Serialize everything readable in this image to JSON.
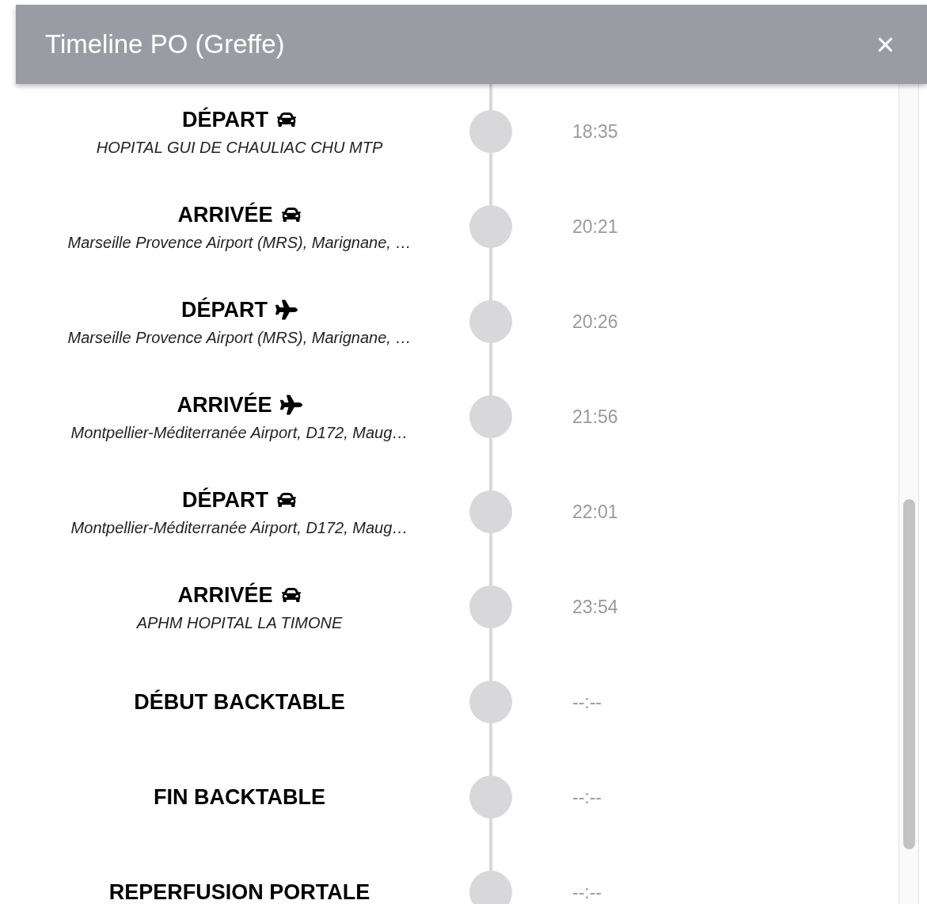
{
  "dialog": {
    "title": "Timeline PO (Greffe)",
    "close": "×"
  },
  "events": [
    {
      "title": "DÉPART",
      "kind": "car",
      "place": "HOPITAL GUI DE CHAULIAC CHU MTP",
      "time": "18:35"
    },
    {
      "title": "ARRIVÉE",
      "kind": "car",
      "place": "Marseille Provence Airport (MRS), Marignane, …",
      "time": "20:21"
    },
    {
      "title": "DÉPART",
      "kind": "plane",
      "place": "Marseille Provence Airport (MRS), Marignane, …",
      "time": "20:26"
    },
    {
      "title": "ARRIVÉE",
      "kind": "plane",
      "place": "Montpellier-Méditerranée Airport, D172, Maug…",
      "time": "21:56"
    },
    {
      "title": "DÉPART",
      "kind": "car",
      "place": "Montpellier-Méditerranée Airport, D172, Maug…",
      "time": "22:01"
    },
    {
      "title": "ARRIVÉE",
      "kind": "car",
      "place": "APHM HOPITAL LA TIMONE",
      "time": "23:54"
    },
    {
      "title": "DÉBUT BACKTABLE",
      "kind": "step",
      "time": "--:--"
    },
    {
      "title": "FIN BACKTABLE",
      "kind": "step",
      "time": "--:--"
    },
    {
      "title": "REPERFUSION PORTALE",
      "kind": "step",
      "time": "--:--"
    }
  ]
}
